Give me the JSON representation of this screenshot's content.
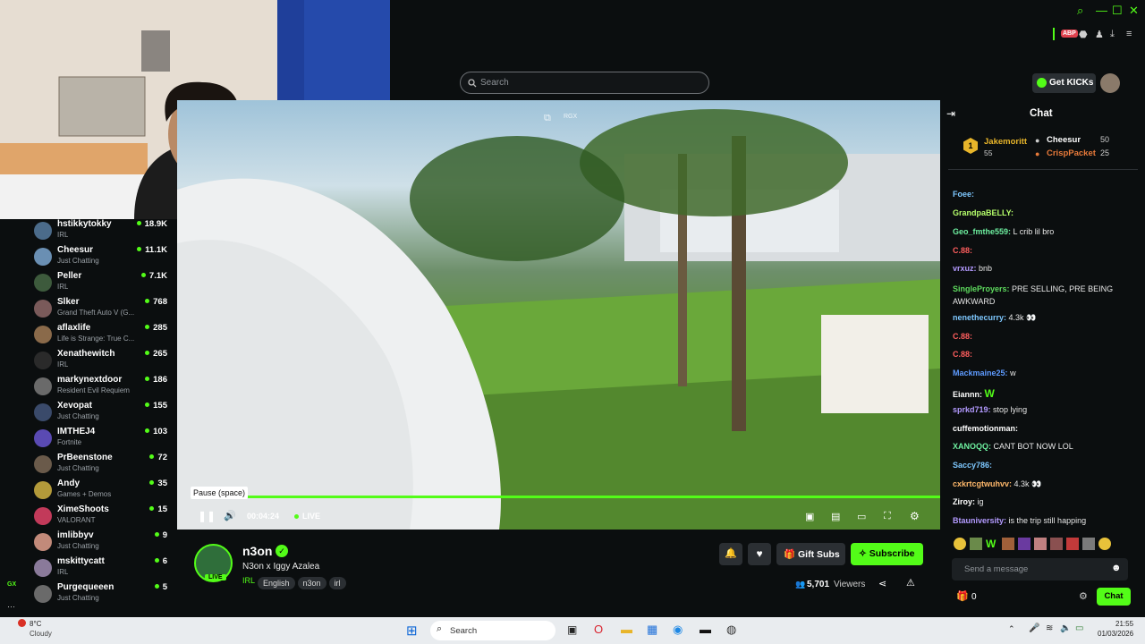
{
  "browser": {
    "window_buttons": [
      "⌕",
      "—",
      "☐",
      "✕"
    ],
    "ext_buttons": [
      "ABP",
      "⬣",
      "♟",
      "⤓",
      "≡"
    ]
  },
  "header": {
    "search_placeholder": "Search",
    "get_kicks": "Get KICKs"
  },
  "sidebar": {
    "channels": [
      {
        "name": "hstikkytokky",
        "category": "IRL",
        "viewers": "18.9K",
        "color": "#4b6b8a"
      },
      {
        "name": "Cheesur",
        "category": "Just Chatting",
        "viewers": "11.1K",
        "color": "#6a8fb3"
      },
      {
        "name": "Peller",
        "category": "IRL",
        "viewers": "7.1K",
        "color": "#3d5a3c"
      },
      {
        "name": "Slker",
        "category": "Grand Theft Auto V (G...",
        "viewers": "768",
        "color": "#7a5a5a"
      },
      {
        "name": "aflaxlife",
        "category": "Life is Strange: True C...",
        "viewers": "285",
        "color": "#8a6a4a"
      },
      {
        "name": "Xenathewitch",
        "category": "IRL",
        "viewers": "265",
        "color": "#2a2a2a"
      },
      {
        "name": "markynextdoor",
        "category": "Resident Evil Requiem",
        "viewers": "186",
        "color": "#6a6a6a"
      },
      {
        "name": "Xevopat",
        "category": "Just Chatting",
        "viewers": "155",
        "color": "#3a4a6a"
      },
      {
        "name": "IMTHEJ4",
        "category": "Fortnite",
        "viewers": "103",
        "color": "#5a4ab3"
      },
      {
        "name": "PrBeenstone",
        "category": "Just Chatting",
        "viewers": "72",
        "color": "#6a5a4a"
      },
      {
        "name": "Andy",
        "category": "Games + Demos",
        "viewers": "35",
        "color": "#b39a3a"
      },
      {
        "name": "XimeShoots",
        "category": "VALORANT",
        "viewers": "15",
        "color": "#c23a5a"
      },
      {
        "name": "imlibbyv",
        "category": "Just Chatting",
        "viewers": "9",
        "color": "#c28a7a"
      },
      {
        "name": "mskittycatt",
        "category": "IRL",
        "viewers": "6",
        "color": "#8a7a9a"
      },
      {
        "name": "Purgequeeen",
        "category": "Just Chatting",
        "viewers": "5",
        "color": "#6a6a6a"
      }
    ],
    "kick_badge": "GX"
  },
  "player": {
    "tooltip": "Pause (space)",
    "time": "00:04:24",
    "live": "LIVE",
    "overlay_tag": "RGX",
    "progress_fraction": 1.0
  },
  "stream": {
    "name": "n3on",
    "title": "N3on x Iggy Azalea",
    "category": "IRL",
    "tags": [
      "English",
      "n3on",
      "irl"
    ],
    "live_badge": "LIVE",
    "gift_subs": "Gift Subs",
    "subscribe": "Subscribe",
    "viewers": "5,701",
    "viewers_label": "Viewers"
  },
  "chat": {
    "title": "Chat",
    "leaderboard": [
      {
        "rank": "1",
        "name": "Jakemoritt",
        "amount": "55"
      },
      {
        "name": "Cheesur",
        "amount": "50"
      },
      {
        "name": "CrispPacket",
        "amount": "25"
      }
    ],
    "messages": [
      {
        "user": "Foee:",
        "text": "",
        "color": "#7ec8ff"
      },
      {
        "user": "GrandpaBELLY:",
        "text": "",
        "color": "#b6ff6b"
      },
      {
        "user": "Geo_fmthe559:",
        "text": "L crib lil bro",
        "color": "#6ef0a0"
      },
      {
        "user": "C.88:",
        "text": "",
        "color": "#ff5e5e"
      },
      {
        "user": "vrxuz:",
        "text": "bnb",
        "color": "#b39aff"
      },
      {
        "user": "SingleProyers:",
        "text": "PRE SELLING, PRE BEING AWKWARD",
        "color": "#5edb5e"
      },
      {
        "user": "nenethecurry:",
        "text": "4.3k 👀",
        "color": "#7ec8ff"
      },
      {
        "user": "C.88:",
        "text": "",
        "color": "#ff5e5e"
      },
      {
        "user": "C.88:",
        "text": "",
        "color": "#ff5e5e"
      },
      {
        "user": "Mackmaine25:",
        "text": "w",
        "color": "#5e9bff"
      },
      {
        "user": "Eiannn:",
        "text": "W",
        "color": "#ffffff"
      },
      {
        "user": "sprkd719:",
        "text": "stop lying",
        "color": "#b39aff"
      },
      {
        "user": "cuffemotionman:",
        "text": "",
        "color": "#ffffff"
      },
      {
        "user": "XANOQQ:",
        "text": "CANT BOT NOW LOL",
        "color": "#6ef0a0"
      },
      {
        "user": "Saccy786:",
        "text": "",
        "color": "#7ec8ff"
      },
      {
        "user": "cxkrtcgtwuhvv:",
        "text": "4.3k 👀",
        "color": "#ffb86b"
      },
      {
        "user": "Ziroy:",
        "text": "ig",
        "color": "#ffffff"
      },
      {
        "user": "Btauniversity:",
        "text": "is the trip still happing",
        "color": "#b39aff"
      }
    ],
    "send_placeholder": "Send a message",
    "kicks_count": "0",
    "chat_button": "Chat"
  },
  "taskbar": {
    "weather_temp": "8°C",
    "weather_desc": "Cloudy",
    "search": "Search",
    "time": "21:55",
    "date": "01/03/2026"
  },
  "colors": {
    "accent": "#53fc18",
    "bg": "#0b0e0f"
  }
}
